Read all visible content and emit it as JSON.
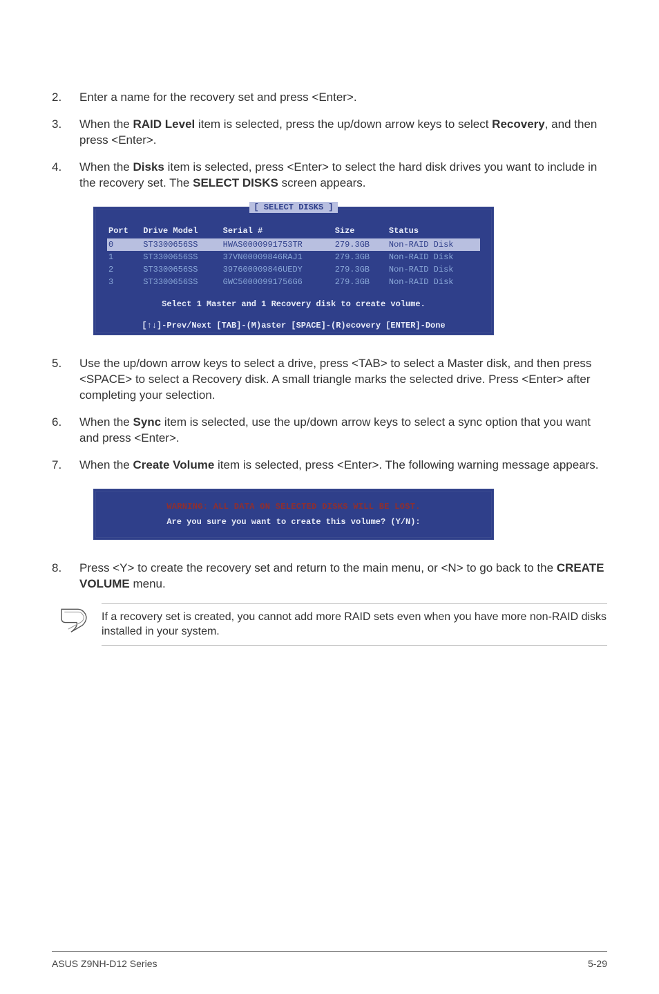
{
  "steps_a": [
    {
      "num": "2.",
      "html": "Enter a name for the recovery set and press <Enter>."
    },
    {
      "num": "3.",
      "html": "When the <b>RAID Level</b> item is selected, press the up/down arrow keys to select <b>Recovery</b>, and then press <Enter>."
    },
    {
      "num": "4.",
      "html": "When the <b>Disks</b> item is selected, press <Enter> to select the hard disk drives you want to include in the recovery set. The <b>SELECT DISKS</b> screen appears."
    }
  ],
  "bios": {
    "title": "[ SELECT DISKS ]",
    "headers": [
      "Port",
      "Drive Model",
      "Serial #",
      "Size",
      "Status"
    ],
    "rows": [
      {
        "hl": true,
        "c": [
          "0",
          "ST3300656SS",
          "HWAS0000991753TR",
          "279.3GB",
          "Non-RAID Disk"
        ]
      },
      {
        "hl": false,
        "c": [
          "1",
          "ST3300656SS",
          "37VN00009846RAJ1",
          "279.3GB",
          "Non-RAID Disk"
        ]
      },
      {
        "hl": false,
        "c": [
          "2",
          "ST3300656SS",
          "397600009846UEDY",
          "279.3GB",
          "Non-RAID Disk"
        ]
      },
      {
        "hl": false,
        "c": [
          "3",
          "ST3300656SS",
          "GWC50000991756G6",
          "279.3GB",
          "Non-RAID Disk"
        ]
      }
    ],
    "message": "Select 1 Master and 1 Recovery disk to create volume.",
    "footer": "[↑↓]-Prev/Next [TAB]-(M)aster [SPACE]-(R)ecovery [ENTER]-Done"
  },
  "steps_b": [
    {
      "num": "5.",
      "html": "Use the up/down arrow keys to select a drive, press <TAB> to select a Master disk, and then press <SPACE> to select a Recovery disk. A small triangle marks the selected drive. Press <Enter> after completing your selection."
    },
    {
      "num": "6.",
      "html": "When the <b>Sync</b> item is selected, use the up/down arrow keys to select a sync option that you want and press <Enter>."
    },
    {
      "num": "7.",
      "html": "When the <b>Create Volume</b> item is selected, press <Enter>. The following warning message appears."
    }
  ],
  "warning": {
    "line1": "WARNING: ALL DATA ON SELECTED DISKS WILL BE LOST.",
    "line2": "Are you sure you want to create this volume? (Y/N):"
  },
  "steps_c": [
    {
      "num": "8.",
      "html": "Press <Y> to create the recovery set and return to the main menu, or <N> to go back to the <b>CREATE VOLUME</b> menu."
    }
  ],
  "note": "If a recovery set is created, you cannot add more RAID sets even when you have more non-RAID disks installed in your system.",
  "footer": {
    "left": "ASUS Z9NH-D12 Series",
    "right": "5-29"
  }
}
